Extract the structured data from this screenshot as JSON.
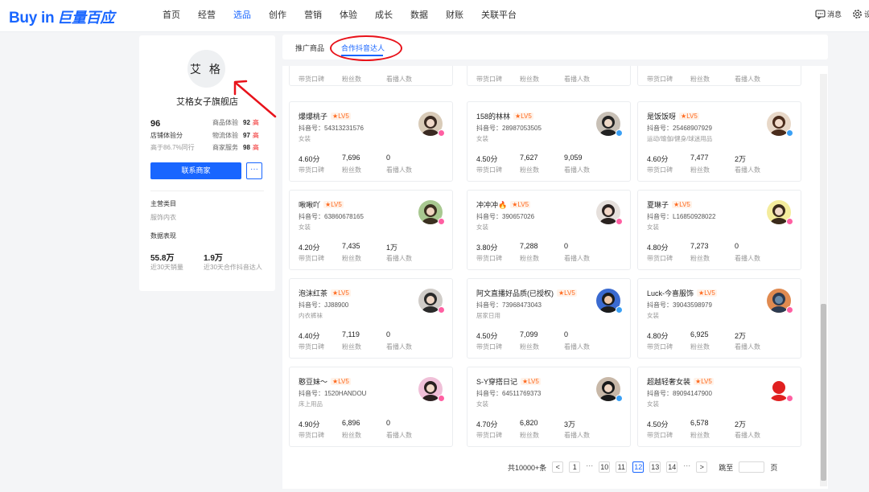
{
  "brand": {
    "logo_en": "Buy in",
    "logo_cn": "巨量百应",
    "accent": "#1966ff"
  },
  "nav": {
    "items": [
      "首页",
      "经营",
      "选品",
      "创作",
      "营销",
      "体验",
      "成长",
      "数据",
      "财账",
      "关联平台"
    ],
    "active": 2,
    "msg_label": "消息",
    "settings_label": "设"
  },
  "shop": {
    "avatar_text": "艾 格",
    "name": "艾格女子旗舰店",
    "score": "96",
    "score_label": "店铺体验分",
    "score_sub": "高于86.7%同行",
    "metrics": [
      {
        "label": "商品体验",
        "value": "92",
        "level": "高"
      },
      {
        "label": "物流体验",
        "value": "97",
        "level": "高"
      },
      {
        "label": "商家服务",
        "value": "98",
        "level": "高"
      }
    ],
    "contact_label": "联系商家",
    "more_label": "···",
    "main_cat_title": "主营类目",
    "main_cat": "服饰内衣",
    "data_title": "数据表现",
    "stats": [
      {
        "value": "55.8万",
        "label": "近30天销量"
      },
      {
        "value": "1.9万",
        "label": "近30天合作抖音达人"
      }
    ]
  },
  "tabs": [
    {
      "label": "推广商品"
    },
    {
      "label": "合作抖音达人"
    }
  ],
  "stat_labels": [
    "带货口碑",
    "粉丝数",
    "看播人数"
  ],
  "creators": [
    {
      "name": "爆爆桃子",
      "lv": "LV5",
      "id": "抖音号：54313231576",
      "cat": "女装",
      "rating": "4.60分",
      "fans": "7,696",
      "viewers": "0",
      "colors": [
        "#d9cbb8",
        "#3a2a22",
        "#f0d8c8"
      ],
      "badge": "#ff5fa2"
    },
    {
      "name": "158的林林",
      "lv": "LV5",
      "id": "抖音号：28987053505",
      "cat": "女装",
      "rating": "4.50分",
      "fans": "7,627",
      "viewers": "9,059",
      "colors": [
        "#c8c0b6",
        "#222222",
        "#eed8c6"
      ],
      "badge": "#3aa0f5"
    },
    {
      "name": "是饭饭呀",
      "lv": "LV5",
      "id": "抖音号：25468907929",
      "cat": "运动/瑜伽/健身/球迷用品",
      "rating": "4.60分",
      "fans": "7,477",
      "viewers": "2万",
      "colors": [
        "#e8d8c8",
        "#4a2c1c",
        "#f3dccb"
      ],
      "badge": "#3aa0f5"
    },
    {
      "name": "啾啾吖",
      "lv": "LV5",
      "id": "抖音号：63860678165",
      "cat": "女装",
      "rating": "4.20分",
      "fans": "7,435",
      "viewers": "1万",
      "colors": [
        "#a8c890",
        "#3a3020",
        "#efd4c0"
      ],
      "badge": "#ff5fa2"
    },
    {
      "name": "冲冲冲🔥",
      "lv": "LV5",
      "id": "抖音号：390657026",
      "cat": "女装",
      "rating": "3.80分",
      "fans": "7,288",
      "viewers": "0",
      "colors": [
        "#e6e0dc",
        "#2a2220",
        "#f2d6c6"
      ],
      "badge": "#ff5fa2"
    },
    {
      "name": "夏琳子",
      "lv": "LV5",
      "id": "抖音号：L16850928022",
      "cat": "女装",
      "rating": "4.80分",
      "fans": "7,273",
      "viewers": "0",
      "colors": [
        "#f4ec9c",
        "#3a2a1a",
        "#f2dac8"
      ],
      "badge": "#ff5fa2"
    },
    {
      "name": "泡沫红茶",
      "lv": "LV5",
      "id": "抖音号：JJ88900",
      "cat": "内衣裤袜",
      "rating": "4.40分",
      "fans": "7,119",
      "viewers": "0",
      "colors": [
        "#d0ccc8",
        "#2a2a2a",
        "#efd6c4"
      ],
      "badge": "#ff5fa2"
    },
    {
      "name": "阿文直播好品质(已授权)",
      "lv": "LV5",
      "id": "抖音号：73968473043",
      "cat": "居家日用",
      "rating": "4.50分",
      "fans": "7,099",
      "viewers": "0",
      "colors": [
        "#3a6ad0",
        "#1c1c1c",
        "#f0c8a8"
      ],
      "badge": "#3aa0f5"
    },
    {
      "name": "Luck-今喜服饰",
      "lv": "LV5",
      "id": "抖音号：39043598979",
      "cat": "女装",
      "rating": "4.80分",
      "fans": "6,925",
      "viewers": "2万",
      "colors": [
        "#e08a50",
        "#2c3a50",
        "#6a8aa8"
      ],
      "badge": "#ff5fa2"
    },
    {
      "name": "憨豆妹～",
      "lv": "LV5",
      "id": "抖音号：1520HANDOU",
      "cat": "床上用品",
      "rating": "4.90分",
      "fans": "6,896",
      "viewers": "0",
      "colors": [
        "#f0c0d8",
        "#2a2020",
        "#f2d8c8"
      ],
      "badge": "#ff5fa2"
    },
    {
      "name": "S-Y穿搭日记",
      "lv": "LV5",
      "id": "抖音号：64511769373",
      "cat": "女装",
      "rating": "4.70分",
      "fans": "6,820",
      "viewers": "3万",
      "colors": [
        "#c8b8a8",
        "#1a1a1a",
        "#f0d6c2"
      ],
      "badge": "#3aa0f5"
    },
    {
      "name": "超越轻奢女装",
      "lv": "LV5",
      "id": "抖音号：89094147900",
      "cat": "女装",
      "rating": "4.50分",
      "fans": "6,578",
      "viewers": "2万",
      "colors": [
        "#ffffff",
        "#e02020",
        "#e02020"
      ],
      "badge": "#ff5fa2"
    }
  ],
  "pagination": {
    "total": "共10000+条",
    "prev": "<",
    "next": ">",
    "pages": [
      "1",
      "···",
      "10",
      "11",
      "12",
      "13",
      "14",
      "···"
    ],
    "current": "12",
    "jump_label": "跳至",
    "page_unit": "页"
  },
  "annotation_color": "#e8121a"
}
